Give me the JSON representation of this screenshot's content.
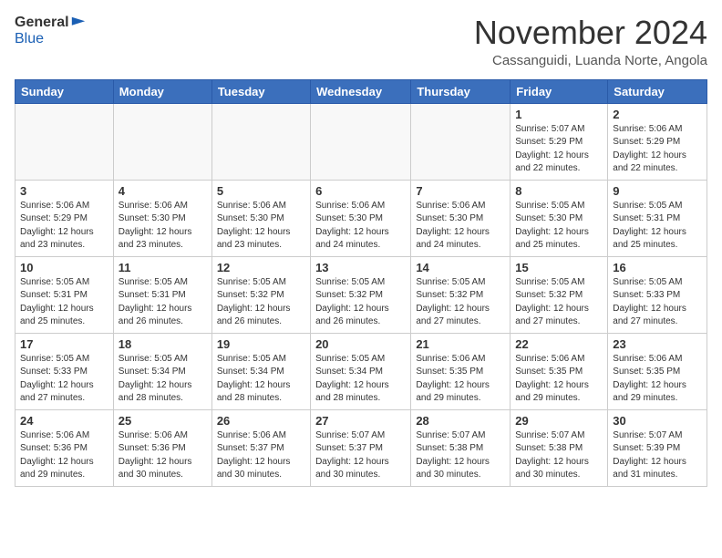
{
  "header": {
    "logo_general": "General",
    "logo_blue": "Blue",
    "month_title": "November 2024",
    "subtitle": "Cassanguidi, Luanda Norte, Angola"
  },
  "calendar": {
    "days_of_week": [
      "Sunday",
      "Monday",
      "Tuesday",
      "Wednesday",
      "Thursday",
      "Friday",
      "Saturday"
    ],
    "weeks": [
      [
        {
          "day": "",
          "info": ""
        },
        {
          "day": "",
          "info": ""
        },
        {
          "day": "",
          "info": ""
        },
        {
          "day": "",
          "info": ""
        },
        {
          "day": "",
          "info": ""
        },
        {
          "day": "1",
          "info": "Sunrise: 5:07 AM\nSunset: 5:29 PM\nDaylight: 12 hours\nand 22 minutes."
        },
        {
          "day": "2",
          "info": "Sunrise: 5:06 AM\nSunset: 5:29 PM\nDaylight: 12 hours\nand 22 minutes."
        }
      ],
      [
        {
          "day": "3",
          "info": "Sunrise: 5:06 AM\nSunset: 5:29 PM\nDaylight: 12 hours\nand 23 minutes."
        },
        {
          "day": "4",
          "info": "Sunrise: 5:06 AM\nSunset: 5:30 PM\nDaylight: 12 hours\nand 23 minutes."
        },
        {
          "day": "5",
          "info": "Sunrise: 5:06 AM\nSunset: 5:30 PM\nDaylight: 12 hours\nand 23 minutes."
        },
        {
          "day": "6",
          "info": "Sunrise: 5:06 AM\nSunset: 5:30 PM\nDaylight: 12 hours\nand 24 minutes."
        },
        {
          "day": "7",
          "info": "Sunrise: 5:06 AM\nSunset: 5:30 PM\nDaylight: 12 hours\nand 24 minutes."
        },
        {
          "day": "8",
          "info": "Sunrise: 5:05 AM\nSunset: 5:30 PM\nDaylight: 12 hours\nand 25 minutes."
        },
        {
          "day": "9",
          "info": "Sunrise: 5:05 AM\nSunset: 5:31 PM\nDaylight: 12 hours\nand 25 minutes."
        }
      ],
      [
        {
          "day": "10",
          "info": "Sunrise: 5:05 AM\nSunset: 5:31 PM\nDaylight: 12 hours\nand 25 minutes."
        },
        {
          "day": "11",
          "info": "Sunrise: 5:05 AM\nSunset: 5:31 PM\nDaylight: 12 hours\nand 26 minutes."
        },
        {
          "day": "12",
          "info": "Sunrise: 5:05 AM\nSunset: 5:32 PM\nDaylight: 12 hours\nand 26 minutes."
        },
        {
          "day": "13",
          "info": "Sunrise: 5:05 AM\nSunset: 5:32 PM\nDaylight: 12 hours\nand 26 minutes."
        },
        {
          "day": "14",
          "info": "Sunrise: 5:05 AM\nSunset: 5:32 PM\nDaylight: 12 hours\nand 27 minutes."
        },
        {
          "day": "15",
          "info": "Sunrise: 5:05 AM\nSunset: 5:32 PM\nDaylight: 12 hours\nand 27 minutes."
        },
        {
          "day": "16",
          "info": "Sunrise: 5:05 AM\nSunset: 5:33 PM\nDaylight: 12 hours\nand 27 minutes."
        }
      ],
      [
        {
          "day": "17",
          "info": "Sunrise: 5:05 AM\nSunset: 5:33 PM\nDaylight: 12 hours\nand 27 minutes."
        },
        {
          "day": "18",
          "info": "Sunrise: 5:05 AM\nSunset: 5:34 PM\nDaylight: 12 hours\nand 28 minutes."
        },
        {
          "day": "19",
          "info": "Sunrise: 5:05 AM\nSunset: 5:34 PM\nDaylight: 12 hours\nand 28 minutes."
        },
        {
          "day": "20",
          "info": "Sunrise: 5:05 AM\nSunset: 5:34 PM\nDaylight: 12 hours\nand 28 minutes."
        },
        {
          "day": "21",
          "info": "Sunrise: 5:06 AM\nSunset: 5:35 PM\nDaylight: 12 hours\nand 29 minutes."
        },
        {
          "day": "22",
          "info": "Sunrise: 5:06 AM\nSunset: 5:35 PM\nDaylight: 12 hours\nand 29 minutes."
        },
        {
          "day": "23",
          "info": "Sunrise: 5:06 AM\nSunset: 5:35 PM\nDaylight: 12 hours\nand 29 minutes."
        }
      ],
      [
        {
          "day": "24",
          "info": "Sunrise: 5:06 AM\nSunset: 5:36 PM\nDaylight: 12 hours\nand 29 minutes."
        },
        {
          "day": "25",
          "info": "Sunrise: 5:06 AM\nSunset: 5:36 PM\nDaylight: 12 hours\nand 30 minutes."
        },
        {
          "day": "26",
          "info": "Sunrise: 5:06 AM\nSunset: 5:37 PM\nDaylight: 12 hours\nand 30 minutes."
        },
        {
          "day": "27",
          "info": "Sunrise: 5:07 AM\nSunset: 5:37 PM\nDaylight: 12 hours\nand 30 minutes."
        },
        {
          "day": "28",
          "info": "Sunrise: 5:07 AM\nSunset: 5:38 PM\nDaylight: 12 hours\nand 30 minutes."
        },
        {
          "day": "29",
          "info": "Sunrise: 5:07 AM\nSunset: 5:38 PM\nDaylight: 12 hours\nand 30 minutes."
        },
        {
          "day": "30",
          "info": "Sunrise: 5:07 AM\nSunset: 5:39 PM\nDaylight: 12 hours\nand 31 minutes."
        }
      ]
    ]
  }
}
